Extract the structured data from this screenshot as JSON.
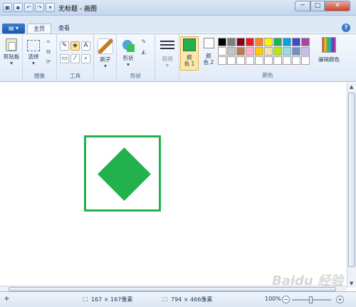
{
  "window": {
    "title": "无标题 - 画图",
    "qat_icons": [
      "paint-app-icon",
      "save-icon",
      "undo-icon",
      "redo-icon",
      "dropdown-icon"
    ],
    "controls": {
      "minimize": "─",
      "maximize": "□",
      "close": "✕"
    }
  },
  "tabs": {
    "file_label": "▤ ▾",
    "home_label": "主页",
    "view_label": "查看",
    "help_label": "?"
  },
  "ribbon": {
    "clipboard": {
      "button": "剪贴板",
      "arrow": "▾",
      "group": ""
    },
    "image": {
      "select": "选择",
      "arrow": "▾",
      "group": "图像"
    },
    "tools": {
      "group": "工具",
      "text_tool": "A"
    },
    "brushes": {
      "label": "刷子",
      "arrow": "▾"
    },
    "shapes": {
      "label": "形状",
      "arrow": "▾",
      "group": "形状"
    },
    "size": {
      "label": "粗细",
      "arrow": "▾"
    },
    "color1": {
      "line1": "颜",
      "line2": "色 1"
    },
    "color2": {
      "line1": "颜",
      "line2": "色 2"
    },
    "colors_group": "颜色",
    "edit_colors": "编辑颜色"
  },
  "palette": [
    "#000000",
    "#7f7f7f",
    "#880015",
    "#ed1c24",
    "#ff7f27",
    "#fff200",
    "#22b14c",
    "#00a2e8",
    "#3f48cc",
    "#a349a4",
    "#ffffff",
    "#c3c3c3",
    "#b97a57",
    "#ffaec9",
    "#ffc90e",
    "#efe4b0",
    "#b5e61d",
    "#99d9ea",
    "#7092be",
    "#c8bfe7",
    "#ffffff",
    "#ffffff",
    "#ffffff",
    "#ffffff",
    "#ffffff",
    "#ffffff",
    "#ffffff",
    "#ffffff",
    "#ffffff",
    "#ffffff"
  ],
  "colors": {
    "color1": "#22b14c",
    "color2": "#ffffff",
    "shape": "#22b14c"
  },
  "status": {
    "cursor_icon": "✛",
    "selection_size": "167 × 167像素",
    "image_size": "794 × 466像素",
    "zoom": "100%",
    "zoom_out": "−",
    "zoom_in": "+"
  },
  "watermark": "Baidu 经验"
}
